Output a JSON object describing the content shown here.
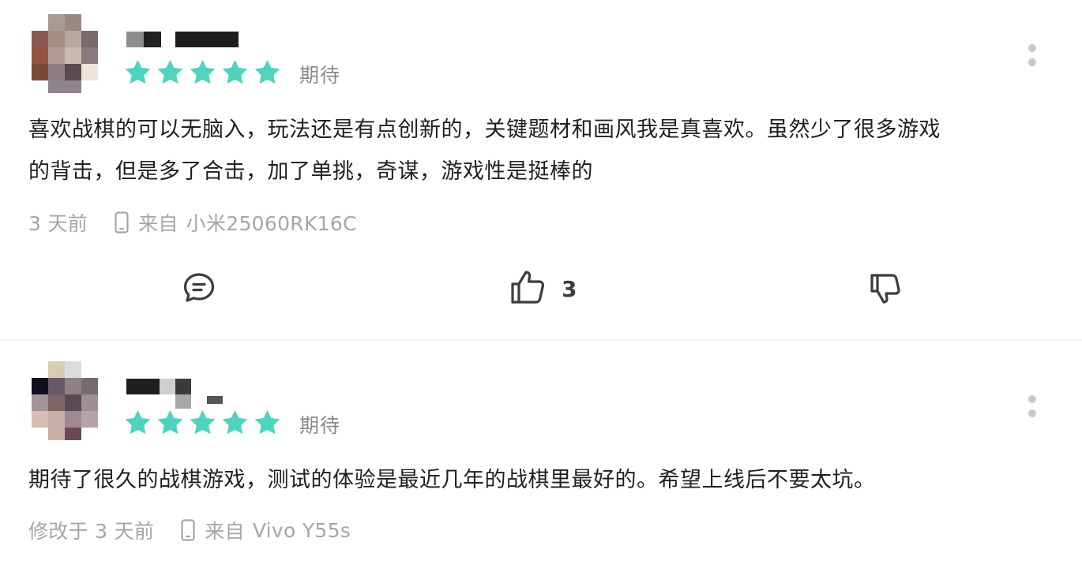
{
  "colors": {
    "star": "#4fd3be",
    "text": "#1f1f1f",
    "muted": "#a6a6a6",
    "divider": "#f1f1f1"
  },
  "reviews": [
    {
      "rating": 5,
      "tag": "期待",
      "content_lines": [
        "喜欢战棋的可以无脑入，玩法还是有点创新的，关键题材和画风我是真喜欢。虽然少了很多游戏",
        "的背击，但是多了合击，加了单挑，奇谋，游戏性是挺棒的"
      ],
      "time": "3 天前",
      "device_prefix": "来自",
      "device": "小米25060RK16C",
      "likes": "3",
      "icons": {
        "comment": "comment-bubble-icon",
        "like": "thumbs-up-icon",
        "dislike": "thumbs-down-icon",
        "more": "more-vertical-icon",
        "device": "phone-icon"
      }
    },
    {
      "rating": 5,
      "tag": "期待",
      "content_lines": [
        "期待了很久的战棋游戏，测试的体验是最近几年的战棋里最好的。希望上线后不要太坑。"
      ],
      "time": "修改于 3 天前",
      "device_prefix": "来自",
      "device": "Vivo Y55s",
      "icons": {
        "more": "more-vertical-icon",
        "device": "phone-icon"
      }
    }
  ]
}
